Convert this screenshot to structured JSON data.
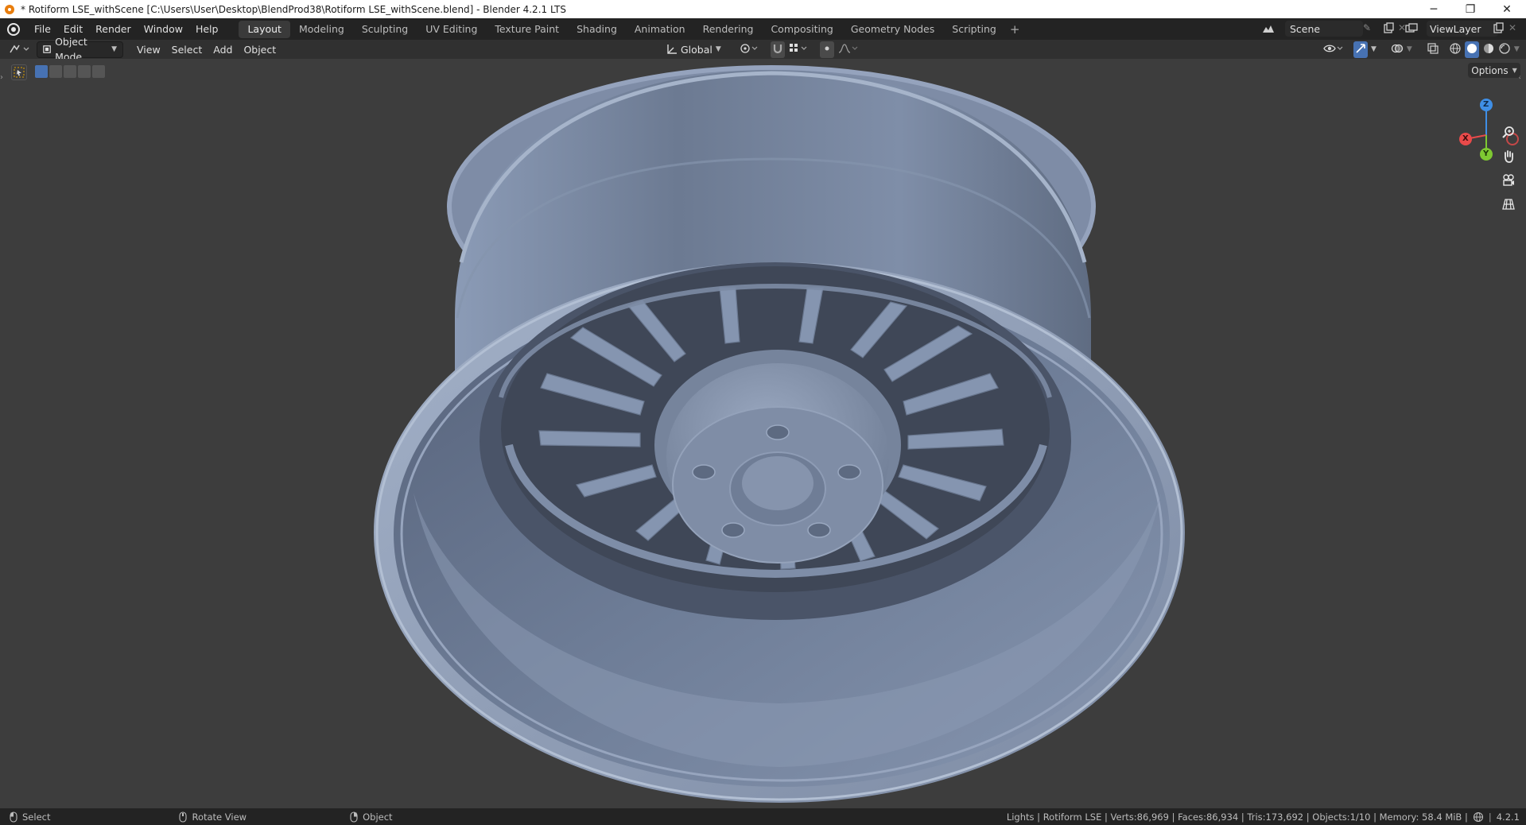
{
  "window": {
    "title": "* Rotiform LSE_withScene [C:\\Users\\User\\Desktop\\BlendProd38\\Rotiform LSE_withScene.blend] - Blender 4.2.1 LTS",
    "minimize_glyph": "─",
    "restore_glyph": "❐",
    "close_glyph": "✕"
  },
  "menu": {
    "items": [
      "File",
      "Edit",
      "Render",
      "Window",
      "Help"
    ]
  },
  "workspaces": {
    "tabs": [
      "Layout",
      "Modeling",
      "Sculpting",
      "UV Editing",
      "Texture Paint",
      "Shading",
      "Animation",
      "Rendering",
      "Compositing",
      "Geometry Nodes",
      "Scripting"
    ],
    "active": "Layout",
    "add_glyph": "+"
  },
  "scene_selector": {
    "value": "Scene"
  },
  "viewlayer_selector": {
    "value": "ViewLayer"
  },
  "viewport_header": {
    "mode": "Object Mode",
    "menus": [
      "View",
      "Select",
      "Add",
      "Object"
    ],
    "transform_orientation": "Global",
    "options_label": "Options"
  },
  "gizmo": {
    "z": "Z",
    "x": "X",
    "y": "Y"
  },
  "status": {
    "left": [
      {
        "label": "Select"
      },
      {
        "label": "Rotate View"
      },
      {
        "label": "Object"
      }
    ],
    "right": "Lights | Rotiform LSE | Verts:86,969 | Faces:86,934 | Tris:173,692 | Objects:1/10 | Memory: 58.4 MiB |",
    "version": "4.2.1"
  },
  "colors": {
    "accent_active": "#4772b3",
    "axis_x": "#e94a4a",
    "axis_y": "#7ec832",
    "axis_z": "#3f8fe6",
    "model": "#7c8aa3"
  }
}
